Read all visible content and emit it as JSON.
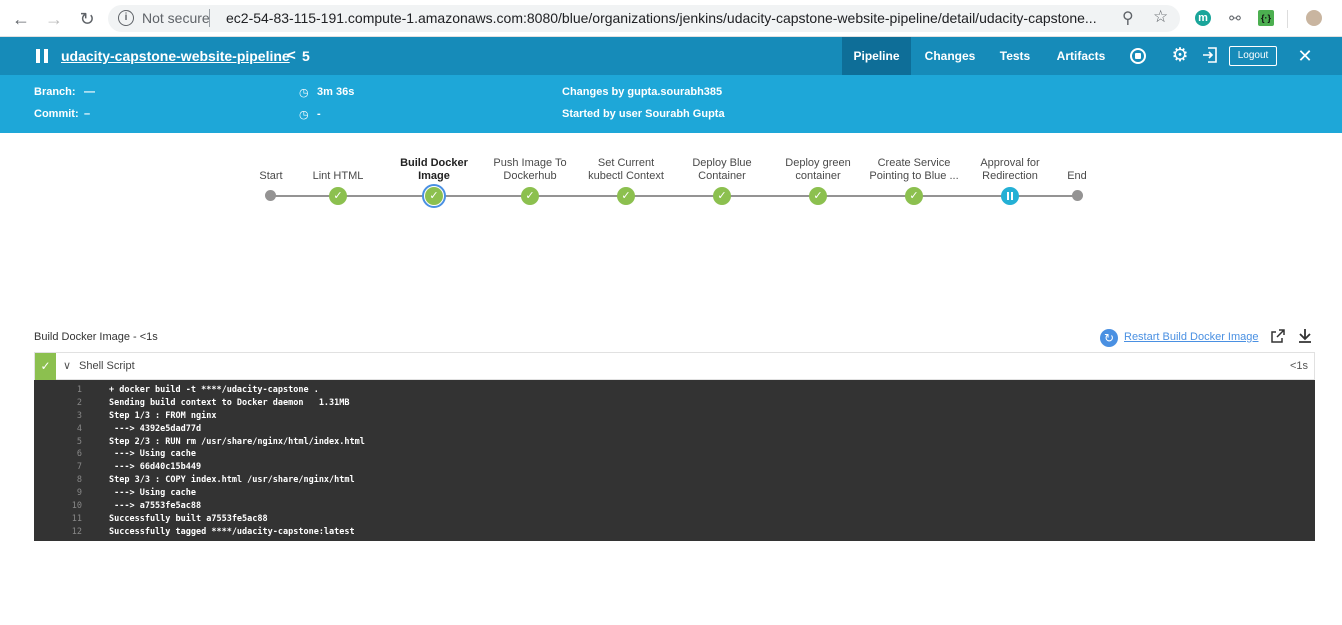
{
  "browser": {
    "security_text": "Not secure",
    "url": "ec2-54-83-115-191.compute-1.amazonaws.com:8080/blue/organizations/jenkins/udacity-capstone-website-pipeline/detail/udacity-capstone...",
    "extension_m_label": "m",
    "extension_json_label": "{·}"
  },
  "header": {
    "pipeline_name": "udacity-capstone-website-pipeline",
    "run_separator": "<",
    "run_number": "5",
    "tabs": [
      {
        "label": "Pipeline"
      },
      {
        "label": "Changes"
      },
      {
        "label": "Tests"
      },
      {
        "label": "Artifacts"
      }
    ],
    "logout_label": "Logout"
  },
  "info": {
    "branch_label": "Branch:",
    "branch_value": "—",
    "commit_label": "Commit:",
    "commit_value": "–",
    "duration": "3m 36s",
    "time_ago": "-",
    "changes_text": "Changes by gupta.sourabh385",
    "started_text": "Started by user Sourabh Gupta"
  },
  "stages": [
    {
      "label": "Start",
      "status": "start"
    },
    {
      "label": "Lint HTML",
      "status": "success"
    },
    {
      "label": "Build Docker Image",
      "status": "success"
    },
    {
      "label": "Push Image To Dockerhub",
      "status": "success"
    },
    {
      "label": "Set Current kubectl Context",
      "status": "success"
    },
    {
      "label": "Deploy Blue Container",
      "status": "success"
    },
    {
      "label": "Deploy green container",
      "status": "success"
    },
    {
      "label": "Create Service Pointing to Blue ...",
      "status": "success"
    },
    {
      "label": "Approval for Redirection",
      "status": "paused"
    },
    {
      "label": "End",
      "status": "end"
    }
  ],
  "step": {
    "title": "Build Docker Image - <1s",
    "restart_label": "Restart Build Docker Image",
    "name": "Shell Script",
    "duration": "<1s"
  },
  "console": [
    {
      "n": "1",
      "t": "+ docker build -t ****/udacity-capstone ."
    },
    {
      "n": "2",
      "t": "Sending build context to Docker daemon   1.31MB"
    },
    {
      "n": "3",
      "t": "Step 1/3 : FROM nginx"
    },
    {
      "n": "4",
      "t": " ---> 4392e5dad77d"
    },
    {
      "n": "5",
      "t": "Step 2/3 : RUN rm /usr/share/nginx/html/index.html"
    },
    {
      "n": "6",
      "t": " ---> Using cache"
    },
    {
      "n": "7",
      "t": " ---> 66d40c15b449"
    },
    {
      "n": "8",
      "t": "Step 3/3 : COPY index.html /usr/share/nginx/html"
    },
    {
      "n": "9",
      "t": " ---> Using cache"
    },
    {
      "n": "10",
      "t": " ---> a7553fe5ac88"
    },
    {
      "n": "11",
      "t": "Successfully built a7553fe5ac88"
    },
    {
      "n": "12",
      "t": "Successfully tagged ****/udacity-capstone:latest"
    }
  ]
}
